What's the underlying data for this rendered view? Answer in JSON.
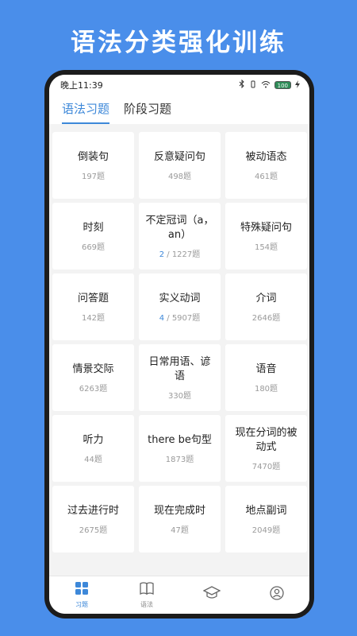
{
  "headline": "语法分类强化训练",
  "status": {
    "time": "晚上11:39",
    "battery": "100"
  },
  "tabs": [
    {
      "label": "语法习题",
      "active": true
    },
    {
      "label": "阶段习题",
      "active": false
    }
  ],
  "cards": [
    {
      "title": "倒装句",
      "count": "197题"
    },
    {
      "title": "反意疑问句",
      "count": "498题"
    },
    {
      "title": "被动语态",
      "count": "461题"
    },
    {
      "title": "时刻",
      "count": "669题"
    },
    {
      "title": "不定冠词（a，an）",
      "done": "2",
      "count": " / 1227题"
    },
    {
      "title": "特殊疑问句",
      "count": "154题"
    },
    {
      "title": "问答题",
      "count": "142题"
    },
    {
      "title": "实义动词",
      "done": "4",
      "count": " / 5907题"
    },
    {
      "title": "介词",
      "count": "2646题"
    },
    {
      "title": "情景交际",
      "count": "6263题"
    },
    {
      "title": "日常用语、谚语",
      "count": "330题"
    },
    {
      "title": "语音",
      "count": "180题"
    },
    {
      "title": "听力",
      "count": "44题"
    },
    {
      "title": "there be句型",
      "count": "1873题"
    },
    {
      "title": "现在分词的被动式",
      "count": "7470题"
    },
    {
      "title": "过去进行时",
      "count": "2675题"
    },
    {
      "title": "现在完成时",
      "count": "47题"
    },
    {
      "title": "地点副词",
      "count": "2049题"
    }
  ],
  "nav": [
    {
      "label": "习题",
      "icon": "grid-icon",
      "active": true
    },
    {
      "label": "语法",
      "icon": "book-icon",
      "active": false
    },
    {
      "label": "",
      "icon": "graduation-cap-icon",
      "active": false
    },
    {
      "label": "",
      "icon": "profile-icon",
      "active": false
    }
  ],
  "colors": {
    "background": "#4a8eea",
    "accent": "#3d88d9"
  }
}
